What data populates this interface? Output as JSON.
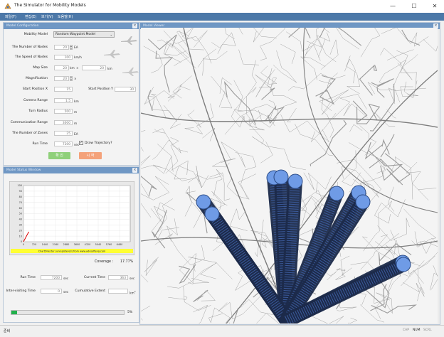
{
  "window": {
    "title": "The Simulator for Mobility Models",
    "minimize": "—",
    "maximize": "☐",
    "close": "✕"
  },
  "menu": [
    "파일(F)",
    "편집(E)",
    "보기(V)",
    "도움말(H)"
  ],
  "config": {
    "header": "Model Configuration",
    "close": "×",
    "mobility_model_label": "Mobility Model",
    "mobility_model_value": "Random Waypoint Model",
    "num_nodes_label": "The Number of Nodes",
    "num_nodes_value": "20",
    "num_nodes_unit": "EA",
    "speed_label": "The Speed of Nodes",
    "speed_value": "100",
    "speed_unit": "km/h",
    "map_size_label": "Map Size",
    "map_w_value": "20",
    "map_w_unit": "km",
    "map_sep": "×",
    "map_h_value": "20",
    "map_h_unit": "km",
    "magnification_label": "Magnification",
    "magnification_value": "20",
    "magnification_unit": "×",
    "start_x_label": "Start Position X",
    "start_x_value": "15",
    "start_y_label": "Start Position Y",
    "start_y_value": "30",
    "camera_label": "Camera Range",
    "camera_value": "1.5",
    "camera_unit": "km",
    "turn_label": "Turn Radius",
    "turn_value": "500",
    "turn_unit": "m",
    "comm_label": "Communication Range",
    "comm_value": "3000",
    "comm_unit": "m",
    "zones_label": "The Number of Zones",
    "zones_value": "25",
    "zones_unit": "EA",
    "runtime_label": "Run Time",
    "runtime_value": "7200",
    "runtime_unit": "sec",
    "draw_traj_label": "Draw Trajectory?",
    "apply_button": "확 인",
    "cancel_button": "시 작"
  },
  "status": {
    "header": "Model Status Window",
    "close": "×",
    "chart_credit": "ChartDirector (unregistered) from www.advsofteng.com",
    "coverage_label": "Coverage :",
    "coverage_value": "17.77%",
    "run_time_label": "Run Time",
    "run_time_value": "7200",
    "run_time_unit": "sec",
    "current_time_label": "Current Time",
    "current_time_value": "363",
    "current_time_unit": "sec",
    "inter_label": "Inter-visiting Time",
    "inter_value": "0",
    "inter_unit": "sec",
    "cumulative_label": "Cumulative Extent",
    "cumulative_unit": "km",
    "cumulative_sup": "2",
    "progress_fraction": 0.05,
    "progress_text": "5%"
  },
  "chart_data": {
    "type": "line",
    "x_ticks": [
      "0",
      "720",
      "1440",
      "2160",
      "2880",
      "3600",
      "4320",
      "5040",
      "5760",
      "6480"
    ],
    "y_ticks": [
      "100",
      "90",
      "80",
      "70",
      "60",
      "50",
      "40",
      "30",
      "20",
      "10",
      "0"
    ],
    "ylim": [
      0,
      100
    ],
    "xlim": [
      0,
      7200
    ],
    "series": [
      {
        "x": [
          0,
          120,
          240,
          363
        ],
        "y": [
          0,
          6,
          12,
          17.77
        ]
      }
    ],
    "series_color": "#dd0000",
    "grid": true
  },
  "viewer": {
    "header": "Model Viewer",
    "close": "×"
  },
  "statusbar": {
    "left": "준비",
    "caps": "CAP",
    "num": "NUM",
    "scrl": "SCRL"
  },
  "colors": {
    "menu_bg": "#4c78a8",
    "panel_header": "#6f97c4",
    "node_fill": "#6f9be6",
    "trail": "#1c2a4a"
  }
}
